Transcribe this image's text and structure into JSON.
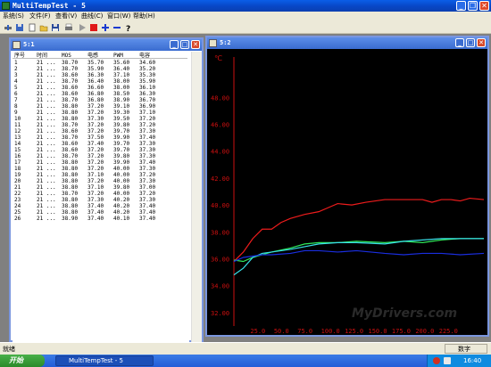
{
  "app": {
    "title": "MultiTempTest - 5",
    "icon": "thermometer-app-icon"
  },
  "menu": [
    "系统(S)",
    "文件(F)",
    "查看(V)",
    "曲线(C)",
    "窗口(W)",
    "帮助(H)"
  ],
  "toolbar": {
    "icons": [
      "scale-icon",
      "save-icon",
      "new-icon",
      "open-icon",
      "disk-icon",
      "print-icon",
      "play-icon",
      "stop-icon",
      "plus-icon",
      "minus-icon",
      "help-icon"
    ]
  },
  "table_window": {
    "title": "5:1",
    "columns": [
      "序号",
      "时间",
      "MOS",
      "电感",
      "PWM",
      "电容"
    ],
    "rows": [
      [
        "1",
        "21 ...",
        "38.70",
        "35.70",
        "35.60",
        "34.60"
      ],
      [
        "2",
        "21 ...",
        "38.70",
        "35.90",
        "36.40",
        "35.20"
      ],
      [
        "3",
        "21 ...",
        "38.60",
        "36.30",
        "37.10",
        "35.30"
      ],
      [
        "4",
        "21 ...",
        "38.70",
        "36.40",
        "38.00",
        "35.90"
      ],
      [
        "5",
        "21 ...",
        "38.60",
        "36.60",
        "38.00",
        "36.10"
      ],
      [
        "6",
        "21 ...",
        "38.60",
        "36.80",
        "38.50",
        "36.30"
      ],
      [
        "7",
        "21 ...",
        "38.70",
        "36.80",
        "38.90",
        "36.70"
      ],
      [
        "8",
        "21 ...",
        "38.80",
        "37.20",
        "39.10",
        "36.90"
      ],
      [
        "9",
        "21 ...",
        "38.80",
        "37.20",
        "39.30",
        "37.10"
      ],
      [
        "10",
        "21 ...",
        "38.80",
        "37.30",
        "39.50",
        "37.20"
      ],
      [
        "11",
        "21 ...",
        "38.70",
        "37.20",
        "39.80",
        "37.20"
      ],
      [
        "12",
        "21 ...",
        "38.60",
        "37.20",
        "39.70",
        "37.30"
      ],
      [
        "13",
        "21 ...",
        "38.70",
        "37.50",
        "39.90",
        "37.40"
      ],
      [
        "14",
        "21 ...",
        "38.60",
        "37.40",
        "39.70",
        "37.30"
      ],
      [
        "15",
        "21 ...",
        "38.60",
        "37.20",
        "39.70",
        "37.30"
      ],
      [
        "16",
        "21 ...",
        "38.70",
        "37.20",
        "39.80",
        "37.30"
      ],
      [
        "17",
        "21 ...",
        "38.80",
        "37.20",
        "39.90",
        "37.40"
      ],
      [
        "18",
        "21 ...",
        "38.80",
        "37.20",
        "40.00",
        "37.30"
      ],
      [
        "19",
        "21 ...",
        "38.80",
        "37.10",
        "40.00",
        "37.20"
      ],
      [
        "20",
        "21 ...",
        "38.80",
        "37.20",
        "40.00",
        "37.30"
      ],
      [
        "21",
        "21 ...",
        "38.80",
        "37.10",
        "39.80",
        "37.00"
      ],
      [
        "22",
        "21 ...",
        "38.70",
        "37.20",
        "40.00",
        "37.20"
      ],
      [
        "23",
        "21 ...",
        "38.80",
        "37.30",
        "40.20",
        "37.30"
      ],
      [
        "24",
        "21 ...",
        "38.80",
        "37.40",
        "40.20",
        "37.40"
      ],
      [
        "25",
        "21 ...",
        "38.80",
        "37.40",
        "40.20",
        "37.40"
      ],
      [
        "26",
        "21 ...",
        "38.90",
        "37.40",
        "40.10",
        "37.40"
      ]
    ]
  },
  "chart_window": {
    "title": "5:2"
  },
  "chart_data": {
    "type": "line",
    "ylabel": "℃",
    "ylim": [
      31,
      51
    ],
    "yticks": [
      "32.00",
      "34.00",
      "36.00",
      "38.00",
      "40.00",
      "42.00",
      "44.00",
      "46.00",
      "48.00"
    ],
    "xticks": [
      "25.0",
      "50.0",
      "75.0",
      "100.0",
      "125.0",
      "150.0",
      "175.0",
      "200.0",
      "225.0"
    ],
    "xlim": [
      0,
      265
    ],
    "colors": {
      "red": "#ee1c1c",
      "green": "#2ee85a",
      "cyan": "#38e0e8",
      "blue": "#1a2ee0"
    },
    "series": [
      {
        "color": "red",
        "x": [
          0,
          10,
          20,
          30,
          40,
          50,
          60,
          75,
          90,
          100,
          110,
          125,
          140,
          160,
          180,
          200,
          210,
          220,
          230,
          240,
          250,
          265
        ],
        "y": [
          35.8,
          36.5,
          37.5,
          38.2,
          38.2,
          38.7,
          39.0,
          39.3,
          39.5,
          39.8,
          40.1,
          40.0,
          40.2,
          40.4,
          40.4,
          40.4,
          40.2,
          40.4,
          40.4,
          40.3,
          40.5,
          40.4
        ]
      },
      {
        "color": "green",
        "x": [
          0,
          10,
          20,
          30,
          40,
          60,
          75,
          90,
          110,
          130,
          160,
          180,
          200,
          220,
          240,
          265
        ],
        "y": [
          35.9,
          35.8,
          36.1,
          36.3,
          36.5,
          36.8,
          37.1,
          37.2,
          37.2,
          37.3,
          37.2,
          37.3,
          37.2,
          37.4,
          37.5,
          37.5
        ]
      },
      {
        "color": "cyan",
        "x": [
          0,
          10,
          20,
          30,
          40,
          60,
          75,
          90,
          110,
          130,
          160,
          180,
          200,
          220,
          240,
          265
        ],
        "y": [
          34.8,
          35.3,
          36.1,
          36.4,
          36.5,
          36.7,
          36.9,
          37.1,
          37.2,
          37.2,
          37.1,
          37.3,
          37.4,
          37.5,
          37.5,
          37.5
        ]
      },
      {
        "color": "blue",
        "x": [
          0,
          10,
          20,
          30,
          40,
          60,
          75,
          90,
          110,
          130,
          160,
          180,
          200,
          220,
          240,
          265
        ],
        "y": [
          35.8,
          36.1,
          36.2,
          36.3,
          36.3,
          36.4,
          36.6,
          36.6,
          36.5,
          36.6,
          36.4,
          36.3,
          36.4,
          36.4,
          36.3,
          36.4
        ]
      }
    ]
  },
  "status": {
    "left": "就绪",
    "right": "数字"
  },
  "taskbar": {
    "start": "开始",
    "task": "MultiTempTest - 5",
    "clock": "16:40"
  },
  "watermark": "MyDrivers.com"
}
